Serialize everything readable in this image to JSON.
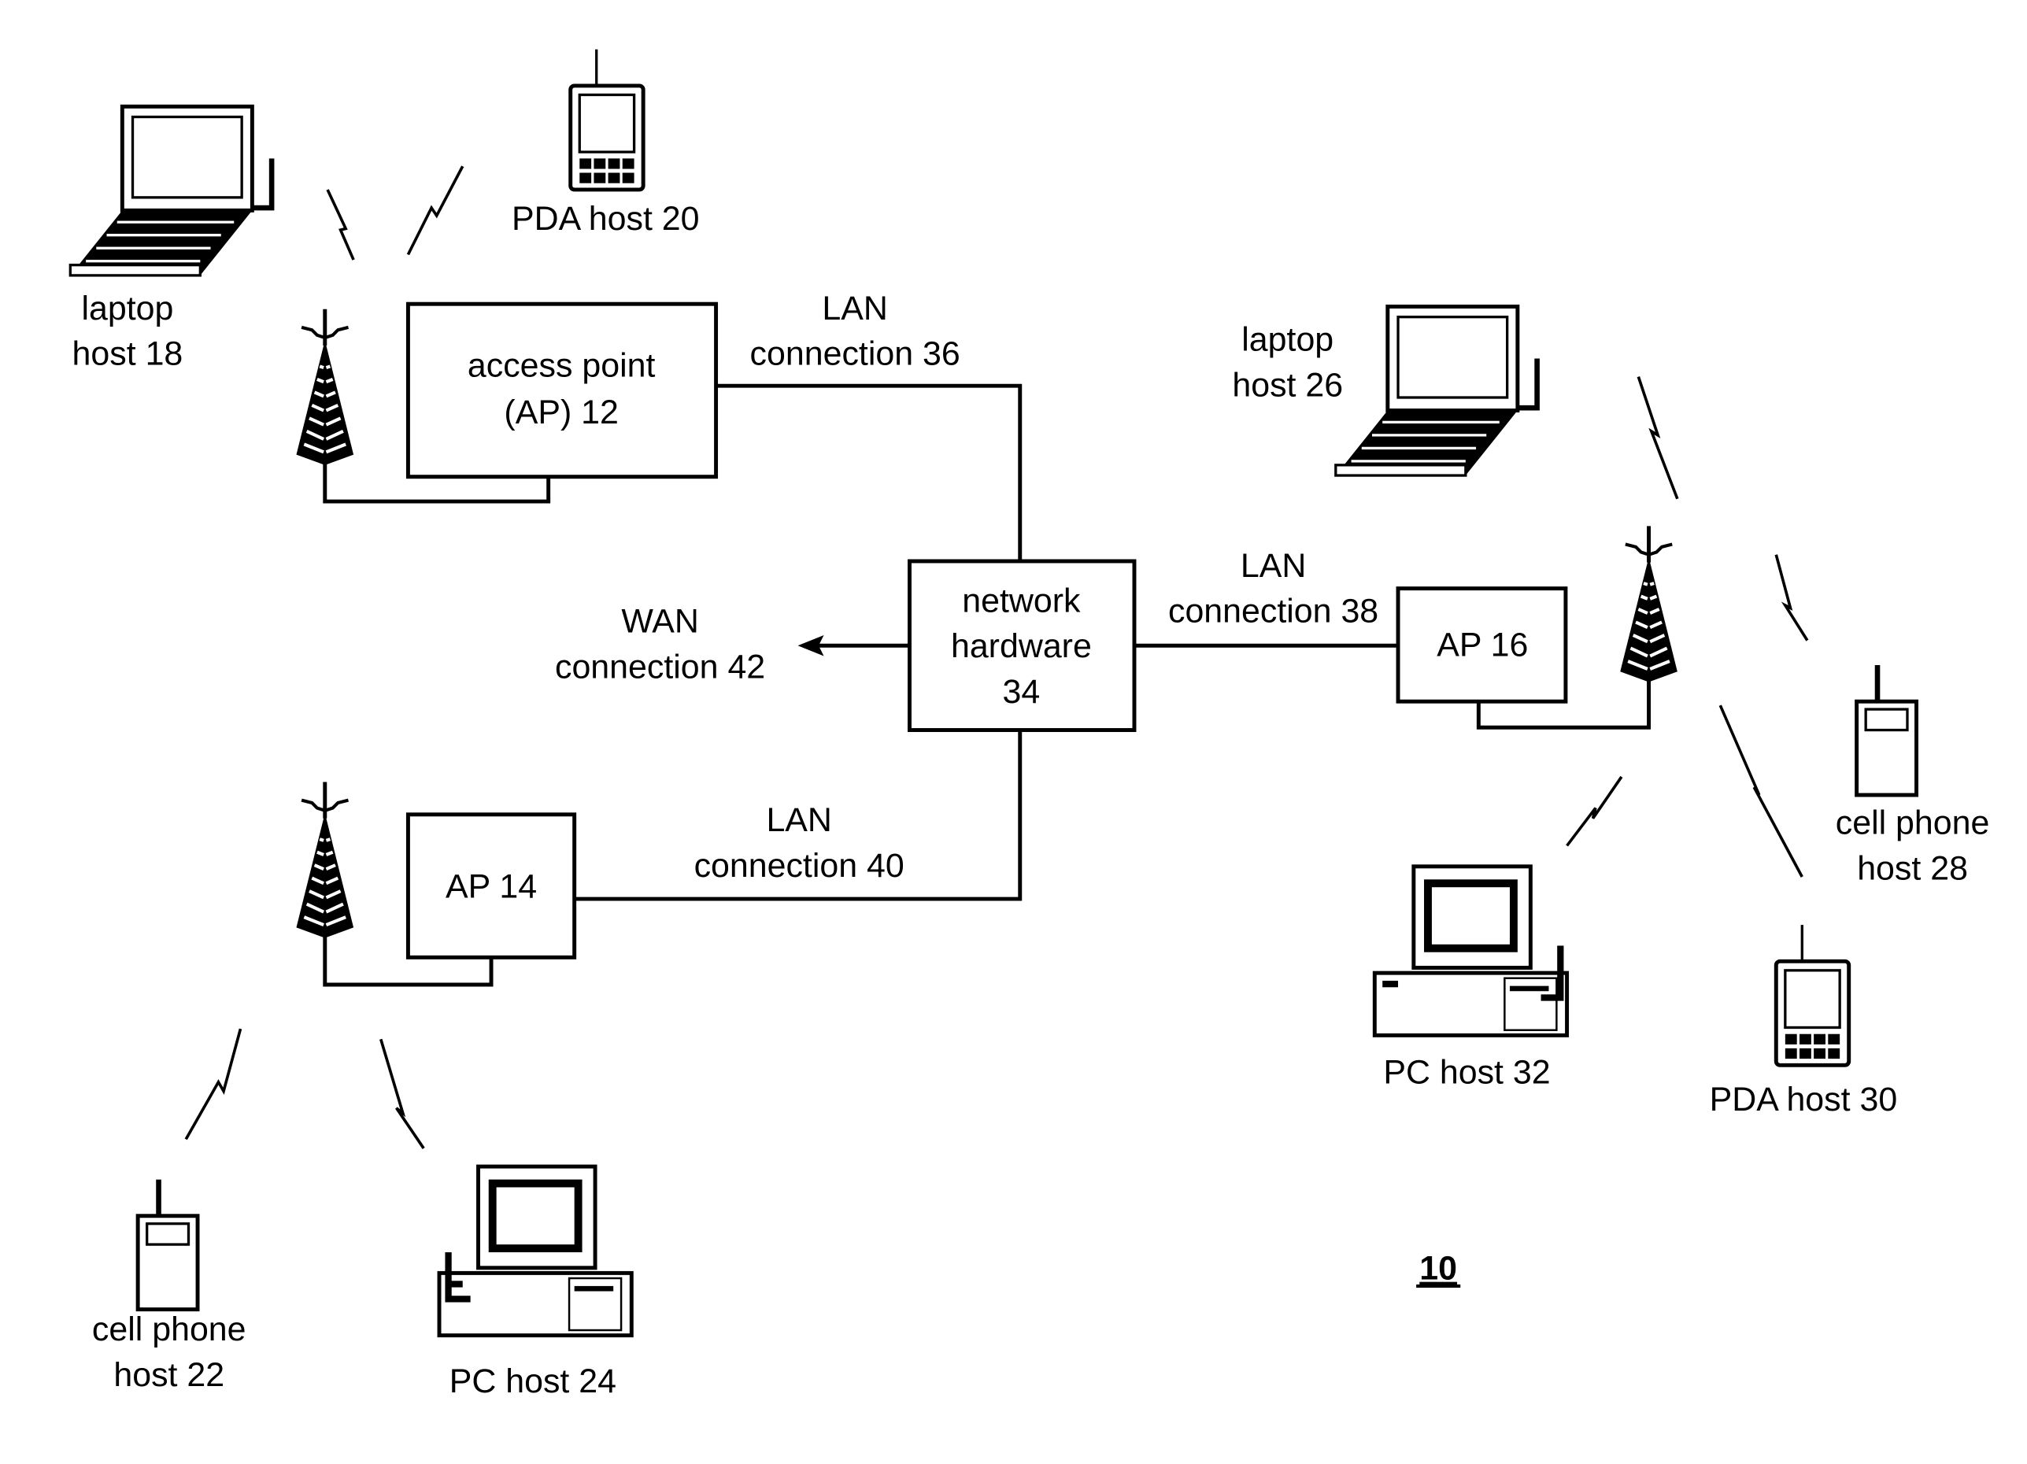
{
  "figure": {
    "reference_number": "10",
    "nodes": {
      "ap12": {
        "line1": "access point",
        "line2": "(AP) 12"
      },
      "ap14": {
        "label": "AP 14"
      },
      "ap16": {
        "label": "AP 16"
      },
      "network_hardware": {
        "line1": "network",
        "line2": "hardware",
        "line3": "34"
      }
    },
    "connections": {
      "lan36": {
        "line1": "LAN",
        "line2": "connection 36"
      },
      "lan38": {
        "line1": "LAN",
        "line2": "connection 38"
      },
      "lan40": {
        "line1": "LAN",
        "line2": "connection 40"
      },
      "wan42": {
        "line1": "WAN",
        "line2": "connection 42"
      }
    },
    "hosts": {
      "laptop18": {
        "line1": "laptop",
        "line2": "host 18",
        "icon": "laptop-icon"
      },
      "pda20": {
        "line1": "PDA host 20",
        "icon": "pda-icon"
      },
      "cell22": {
        "line1": "cell phone",
        "line2": "host 22",
        "icon": "cell-phone-icon"
      },
      "pc24": {
        "line1": "PC host 24",
        "icon": "desktop-pc-icon"
      },
      "laptop26": {
        "line1": "laptop",
        "line2": "host 26",
        "icon": "laptop-icon"
      },
      "cell28": {
        "line1": "cell phone",
        "line2": "host 28",
        "icon": "cell-phone-icon"
      },
      "pda30": {
        "line1": "PDA host 30",
        "icon": "pda-icon"
      },
      "pc32": {
        "line1": "PC host 32",
        "icon": "desktop-pc-icon"
      }
    }
  }
}
